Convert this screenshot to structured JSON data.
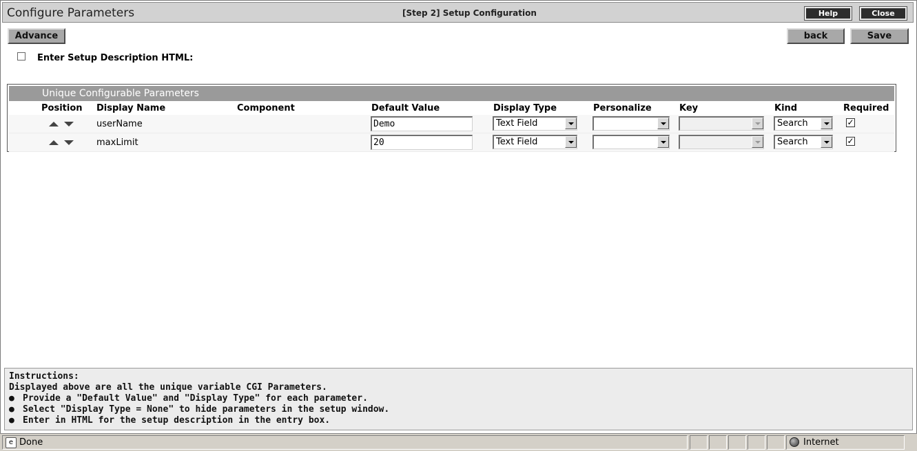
{
  "window": {
    "title": "Configure Parameters",
    "step": "[Step 2] Setup Configuration",
    "help_label": "Help",
    "close_label": "Close"
  },
  "toolbar": {
    "advance_label": "Advance",
    "back_label": "back",
    "save_label": "Save"
  },
  "description": {
    "checkbox_checked": false,
    "label": "Enter Setup Description HTML:"
  },
  "params": {
    "section_title": "Unique Configurable Parameters",
    "headers": {
      "position": "Position",
      "display_name": "Display Name",
      "component": "Component",
      "default_value": "Default Value",
      "display_type": "Display Type",
      "personalize": "Personalize",
      "key": "Key",
      "kind": "Kind",
      "required": "Required"
    },
    "rows": [
      {
        "display_name": "userName",
        "component": "",
        "default_value": "Demo",
        "display_type": "Text Field",
        "personalize": "",
        "key": "",
        "kind": "Search",
        "required": true,
        "required_mark": "✓"
      },
      {
        "display_name": "maxLimit",
        "component": "",
        "default_value": "20",
        "display_type": "Text Field",
        "personalize": "",
        "key": "",
        "kind": "Search",
        "required": true,
        "required_mark": "✓"
      }
    ]
  },
  "instructions": {
    "heading": "Instructions:",
    "intro": "Displayed above are all the unique variable CGI Parameters.",
    "bullet_glyph": "●",
    "bullets": [
      "Provide a \"Default Value\" and \"Display Type\" for each parameter.",
      "Select \"Display Type = None\" to hide parameters in the setup window.",
      "Enter in HTML for the setup description in the entry box."
    ]
  },
  "statusbar": {
    "status": "Done",
    "zone": "Internet",
    "page_icon_glyph": "e"
  }
}
